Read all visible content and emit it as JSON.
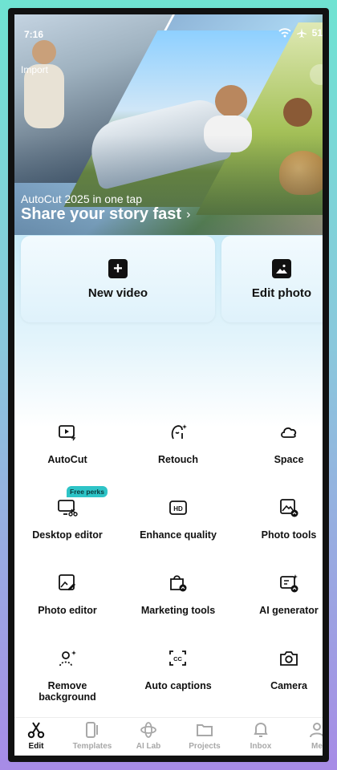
{
  "status": {
    "time": "7:16",
    "battery": "51"
  },
  "hero": {
    "import_label": "Import",
    "subtitle": "AutoCut 2025 in one tap",
    "title": "Share your story fast",
    "chevron": "›"
  },
  "cards": [
    {
      "label": "New video",
      "icon": "plus-square-icon"
    },
    {
      "label": "Edit photo",
      "icon": "image-square-icon"
    }
  ],
  "tools": [
    {
      "label": "AutoCut",
      "icon": "autocut-icon"
    },
    {
      "label": "Retouch",
      "icon": "retouch-icon"
    },
    {
      "label": "Space",
      "icon": "cloud-icon"
    },
    {
      "label": "Desktop editor",
      "icon": "desktop-scissors-icon",
      "badge": "Free perks"
    },
    {
      "label": "Enhance quality",
      "icon": "hd-icon"
    },
    {
      "label": "Photo tools",
      "icon": "photo-tools-icon"
    },
    {
      "label": "Photo editor",
      "icon": "photo-edit-icon"
    },
    {
      "label": "Marketing tools",
      "icon": "marketing-bag-icon"
    },
    {
      "label": "AI generator",
      "icon": "ai-generator-icon"
    },
    {
      "label": "Remove background",
      "icon": "remove-bg-icon"
    },
    {
      "label": "Auto captions",
      "icon": "captions-icon"
    },
    {
      "label": "Camera",
      "icon": "camera-icon"
    }
  ],
  "nav": [
    {
      "label": "Edit",
      "icon": "scissors-icon",
      "active": true
    },
    {
      "label": "Templates",
      "icon": "templates-icon",
      "active": false
    },
    {
      "label": "AI Lab",
      "icon": "ai-lab-icon",
      "active": false
    },
    {
      "label": "Projects",
      "icon": "folder-icon",
      "active": false
    },
    {
      "label": "Inbox",
      "icon": "bell-icon",
      "active": false
    },
    {
      "label": "Me",
      "icon": "person-icon",
      "active": false
    }
  ],
  "colors": {
    "accent": "#2ec4c7",
    "text": "#111111",
    "muted": "#a8a8a8"
  }
}
